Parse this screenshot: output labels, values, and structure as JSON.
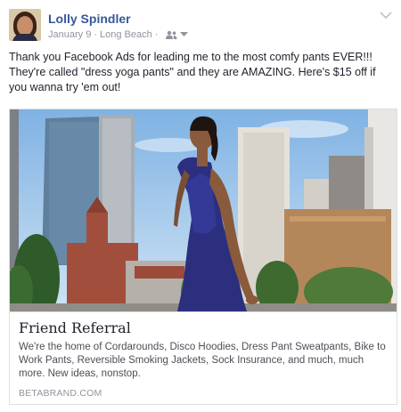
{
  "post": {
    "author": "Lolly Spindler",
    "date": "January 9",
    "separator": "·",
    "location": "Long Beach",
    "audience_icon": "friends-icon",
    "menu_icon": "chevron-down-icon",
    "body": "Thank you Facebook Ads for leading me to the most comfy pants EVER!!! They're called \"dress yoga pants\" and they are AMAZING. Here's $15 off if you wanna try 'em out!"
  },
  "link_preview": {
    "image": "woman-in-blue-dress-city-photo",
    "title": "Friend Referral",
    "description": "We're the home of Cordarounds, Disco Hoodies, Dress Pant Sweatpants, Bike to Work Pants, Reversible Smoking Jackets, Sock Insurance, and much, much more. New ideas, nonstop.",
    "domain": "BETABRAND.COM"
  },
  "colors": {
    "name": "#365899",
    "meta": "#90949c",
    "text": "#1d2129",
    "border": "#dddfe2"
  }
}
